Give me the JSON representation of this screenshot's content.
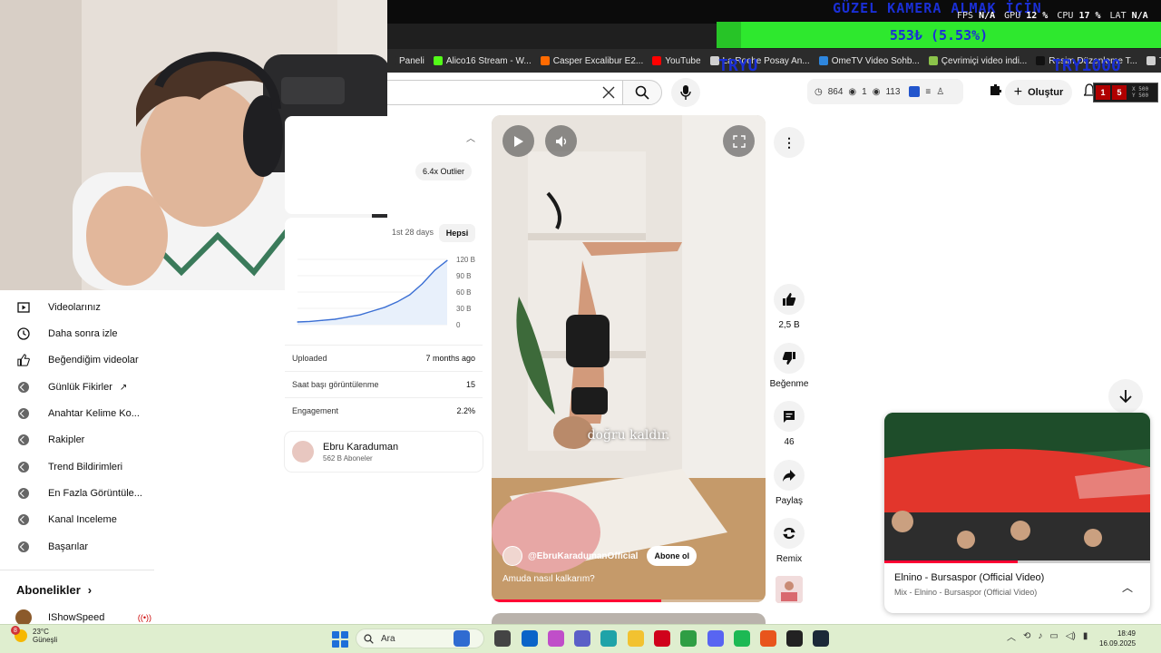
{
  "overlay": {
    "title": "GÜZEL KAMERA ALMAK İÇİN",
    "goal_text": "553₺ (5.53%)",
    "goal_progress": 0.0553,
    "tryu_left": "TRYU",
    "tryu_right": "TRY1000",
    "stats": [
      {
        "label": "FPS",
        "value": "N/A"
      },
      {
        "label": "GPU",
        "value": "12 %"
      },
      {
        "label": "CPU",
        "value": "17 %"
      },
      {
        "label": "LAT",
        "value": "N/A"
      }
    ]
  },
  "bookmarks": [
    {
      "label": "Paneli",
      "color": "#2b2b2b"
    },
    {
      "label": "Alico16 Stream - W...",
      "color": "#53fc18"
    },
    {
      "label": "Casper Excalibur E2...",
      "color": "#ff6a00"
    },
    {
      "label": "YouTube",
      "color": "#ff0000"
    },
    {
      "label": "La Roche Posay An...",
      "color": "#d0d0d0"
    },
    {
      "label": "OmeTV Video Sohb...",
      "color": "#2e86de"
    },
    {
      "label": "Çevrimiçi video indi...",
      "color": "#8bc34a"
    },
    {
      "label": "Resim Düzenleme T...",
      "color": "#111111"
    },
    {
      "label": "Tüm Yer İşaretleri",
      "color": "#d0d0d0"
    }
  ],
  "header": {
    "ext_views": "864",
    "ext_a": "1",
    "ext_b": "113",
    "create_label": "Oluştur",
    "rec_left": "1",
    "rec_right": "5",
    "rec_x": "X 500",
    "rec_y": "Y 500"
  },
  "sidebar": {
    "items": [
      {
        "label": "Videolarınız",
        "icon": "play-box-icon"
      },
      {
        "label": "Daha sonra izle",
        "icon": "clock-icon"
      },
      {
        "label": "Beğendiğim videolar",
        "icon": "thumb-up-icon"
      },
      {
        "label": "Günlük Fikirler",
        "icon": "extension-icon"
      },
      {
        "label": "Anahtar Kelime Ko...",
        "icon": "extension-icon"
      },
      {
        "label": "Rakipler",
        "icon": "extension-icon"
      },
      {
        "label": "Trend Bildirimleri",
        "icon": "extension-icon"
      },
      {
        "label": "En Fazla Görüntüle...",
        "icon": "extension-icon"
      },
      {
        "label": "Kanal Inceleme",
        "icon": "extension-icon"
      },
      {
        "label": "Başarılar",
        "icon": "extension-icon"
      }
    ],
    "subs_heading": "Abonelikler",
    "subscription": "IShowSpeed"
  },
  "analytics": {
    "outlier": "6.4x Outlier",
    "tabs": [
      "1st 28 days",
      "Hepsi"
    ],
    "chart_data": {
      "type": "line",
      "x": [
        0,
        1,
        2,
        3,
        4,
        5,
        6,
        7,
        8,
        9,
        10,
        11,
        12
      ],
      "values": [
        5,
        6,
        8,
        10,
        14,
        18,
        25,
        32,
        42,
        55,
        75,
        100,
        118
      ],
      "ylim": [
        0,
        120
      ],
      "ytick_labels": [
        "120 B",
        "90 B",
        "60 B",
        "30 B",
        "0"
      ]
    },
    "rows": [
      {
        "label": "Uploaded",
        "value": "7 months ago"
      },
      {
        "label": "Saat başı görüntülenme",
        "value": "15"
      },
      {
        "label": "Engagement",
        "value": "2.2%"
      }
    ],
    "channel_name": "Ebru Karaduman",
    "channel_subs": "562 B Aboneler"
  },
  "short": {
    "caption": "doğru kaldır.",
    "handle": "@EbruKaradumanOfficial",
    "subscribe": "Abone ol",
    "title": "Amuda nasıl kalkarım?",
    "progress": 0.62
  },
  "actions": {
    "like": "2,5 B",
    "dislike": "Beğenme",
    "comments": "46",
    "share": "Paylaş",
    "remix": "Remix"
  },
  "miniplayer": {
    "title": "Elnino - Bursaspor (Official Video)",
    "subtitle": "Mix - Elnino - Bursaspor (Official Video)",
    "progress": 0.5
  },
  "taskbar": {
    "temp": "23°C",
    "weather": "Güneşli",
    "badge": "8",
    "search": "Ara",
    "time": "18:49",
    "date": "16.09.2025"
  }
}
